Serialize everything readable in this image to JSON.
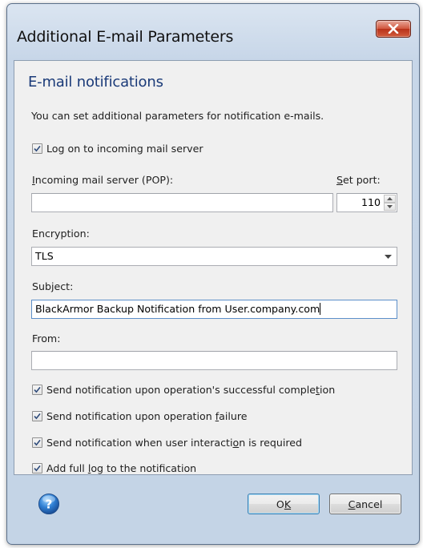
{
  "window": {
    "title": "Additional E-mail Parameters"
  },
  "section": {
    "heading": "E-mail notifications",
    "description": "You can set additional parameters for notification e-mails."
  },
  "login": {
    "checkbox_label": "Log on to incoming mail server",
    "checked": true
  },
  "pop": {
    "label_mnemonic": "I",
    "label_rest": "ncoming mail server (POP):",
    "value": "",
    "port_label_mnemonic": "S",
    "port_label_rest": "et port:",
    "port_value": "110"
  },
  "encryption": {
    "label": "Encryption:",
    "selected": "TLS"
  },
  "subject": {
    "label": "Subject:",
    "value": "BlackArmor Backup Notification from User.company.com"
  },
  "from": {
    "label": "From:",
    "value": ""
  },
  "options": [
    {
      "pre": "Send notification upon operation's successful comple",
      "mn": "t",
      "post": "ion",
      "checked": true
    },
    {
      "pre": "Send notification upon operation ",
      "mn": "f",
      "post": "ailure",
      "checked": true
    },
    {
      "pre": "Send notification when user interacti",
      "mn": "o",
      "post": "n is required",
      "checked": true
    },
    {
      "pre": "Add full ",
      "mn": "l",
      "post": "og to the notification",
      "checked": true
    }
  ],
  "footer": {
    "ok_pre": "O",
    "ok_mn": "K",
    "ok_post": "",
    "cancel_mn": "C",
    "cancel_post": "ancel"
  },
  "icons": {
    "close": "close-icon",
    "help": "help-icon",
    "check": "checkmark-icon",
    "dropdown": "chevron-down-icon"
  },
  "colors": {
    "heading": "#1a3a78",
    "close_button": "#c7432a",
    "help": "#2f7fd3",
    "frame": "#c7d6e8"
  }
}
